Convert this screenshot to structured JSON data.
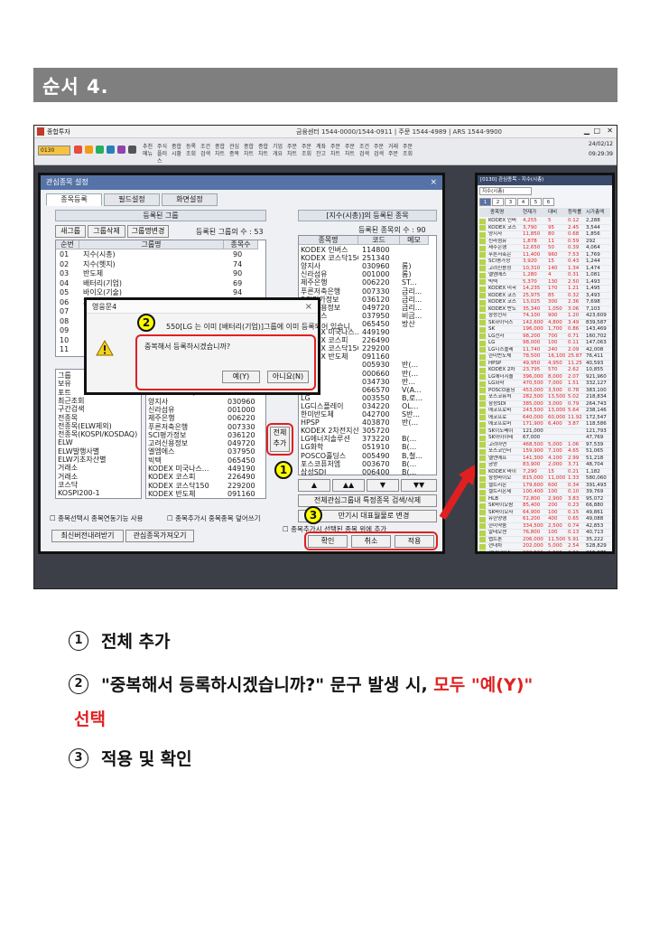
{
  "header": {
    "title": "순서 4."
  },
  "window": {
    "app_title": "종합투자",
    "center_info": "금융센터 1544-0000/1544-0911 | 주문 1544-4989 | ARS 1544-9900",
    "screen_no": "0130",
    "date": "24/02/12",
    "time": "09:29:39",
    "toolbar_items": [
      "추천메뉴",
      "주식플러스",
      "종합시황",
      "등록조회",
      "조건검색",
      "종합차트",
      "관심종목",
      "종합차트",
      "종합차트",
      "기업개요",
      "주문차트",
      "주문조회",
      "계좌잔고",
      "주문차트",
      "주문차트",
      "조건검색",
      "주문검색",
      "거래주문",
      "주문조회"
    ]
  },
  "dialog": {
    "title": "관심종목 설정",
    "close": "×",
    "tabs": [
      "종목등록",
      "필드설정",
      "화면설정"
    ],
    "group_panel": {
      "caption": "등록된 그룹",
      "buttons": [
        "새그룹",
        "그룹삭제",
        "그룹명변경"
      ],
      "count_label": "등록된 그룹의 수 : 53",
      "columns": [
        "순번",
        "그룹명",
        "종목수"
      ],
      "rows": [
        [
          "01",
          "지수(시총)",
          "90"
        ],
        [
          "02",
          "지수(헷지)",
          "74"
        ],
        [
          "03",
          "반도체",
          "90"
        ],
        [
          "04",
          "배터리(기업)",
          "69"
        ],
        [
          "05",
          "바이오(기술)",
          "94"
        ],
        [
          "06",
          "자동차(기업)",
          "86"
        ],
        [
          "07",
          "",
          ""
        ],
        [
          "08",
          "",
          ""
        ],
        [
          "09",
          "",
          ""
        ],
        [
          "10",
          "",
          ""
        ],
        [
          "11",
          "",
          ""
        ]
      ]
    },
    "category_list": [
      "그룹",
      "보유",
      "포트",
      "최근조회",
      "구간검색",
      "전종목",
      "전종목(ELW제외)",
      "전종목(KOSPI/KOSDAQ)",
      "ELW",
      "ELW발행사별",
      "ELW기초자산별",
      "거래소",
      "거래소",
      "코스닥",
      "KOSPI200-1"
    ],
    "stock_mid": [
      [
        "KODEX 인버스",
        "114800"
      ],
      [
        "KODEX 코스닥15...",
        "251340"
      ],
      [
        "양지사",
        "030960"
      ],
      [
        "신라섬유",
        "001000"
      ],
      [
        "제주은행",
        "006220"
      ],
      [
        "푸른저축은행",
        "007330"
      ],
      [
        "SCI평가정보",
        "036120"
      ],
      [
        "고려신용정보",
        "049720"
      ],
      [
        "엘엠에스",
        "037950"
      ],
      [
        "빅텍",
        "065450"
      ],
      [
        "KODEX 미국나스...",
        "449190"
      ],
      [
        "KODEX 코스피",
        "226490"
      ],
      [
        "KODEX 코스닥150",
        "229200"
      ],
      [
        "KODEX 반도체",
        "091160"
      ]
    ],
    "add_all_button": "전체추가",
    "registered_panel": {
      "caption": "[지수(시총)]의 등록된 종목",
      "count_label": "등록된 종목의 수 : 90",
      "columns": [
        "종목명",
        "코드",
        "메모"
      ],
      "rows": [
        [
          "KODEX 인버스",
          "114800",
          ""
        ],
        [
          "KODEX 코스닥150...",
          "251340",
          ""
        ],
        [
          "양지사",
          "030960",
          "롬)"
        ],
        [
          "신라섬유",
          "001000",
          "롬)"
        ],
        [
          "제주은행",
          "006220",
          "ST..."
        ],
        [
          "푸른저축은행",
          "007330",
          "금리..."
        ],
        [
          "SCI평가정보",
          "036120",
          "금리..."
        ],
        [
          "고려신용정보",
          "049720",
          "금리..."
        ],
        [
          "엘엠에스",
          "037950",
          "비금..."
        ],
        [
          "빅텍",
          "065450",
          "방산"
        ],
        [
          "KODEX 미국나스...",
          "449190",
          ""
        ],
        [
          "KODEX 코스피",
          "226490",
          ""
        ],
        [
          "KODEX 코스닥150",
          "229200",
          ""
        ],
        [
          "KODEX 반도체",
          "091160",
          ""
        ],
        [
          "",
          "005930",
          "반(..."
        ],
        [
          "",
          "000660",
          "반(..."
        ],
        [
          "",
          "034730",
          "반..."
        ],
        [
          "",
          "066570",
          "V(A..."
        ],
        [
          "LG",
          "003550",
          "B,로..."
        ],
        [
          "LG디스플레이",
          "034220",
          "OL..."
        ],
        [
          "한미반도체",
          "042700",
          "S반..."
        ],
        [
          "HPSP",
          "403870",
          "반(..."
        ],
        [
          "KODEX 2차전지산업",
          "305720",
          ""
        ],
        [
          "LG에너지솔루션",
          "373220",
          "B(..."
        ],
        [
          "LG화학",
          "051910",
          "B(..."
        ],
        [
          "POSCO홀딩스",
          "005490",
          "B,철..."
        ],
        [
          "포스코퓨처엠",
          "003670",
          "B(..."
        ],
        [
          "삼성SDI",
          "006400",
          "B(..."
        ]
      ],
      "nav_buttons": [
        "▲",
        "▲▲",
        "▼",
        "▼▼"
      ],
      "search_button": "전체관심그룹내 특정종목 검색/삭제",
      "expiry_button": "만기시 대표월물로 변경"
    },
    "options": [
      "종목선택시 종목연동기능 사용",
      "종목추가시 중복종목 덮어쓰기",
      "종목추가시 선택된 종목 위에 추가"
    ],
    "bottom_left_buttons": [
      "최신버전내려받기",
      "관심종목가져오기"
    ],
    "footer_buttons": [
      "확인",
      "취소",
      "적용"
    ]
  },
  "popup": {
    "title": "영웅문4",
    "line1": "550[LG 는 이미 [배터리(기업)]그룹에 이미 등록되어 있습니",
    "line2": "중복해서 등록하시겠습니까?",
    "yes": "예(Y)",
    "no": "아니요(N)",
    "close": "×"
  },
  "right_panel": {
    "title": "[0130] 관심종목 - 지수(시총)",
    "combo": "지수(시총)",
    "tabs": [
      "1",
      "2",
      "3",
      "4",
      "5",
      "6"
    ],
    "columns": [
      "종목명",
      "현재가",
      "대비",
      "등락률",
      "시가총액"
    ],
    "rows": [
      [
        "KODEX 인버",
        "4,255",
        "5",
        "0.12",
        "2,288"
      ],
      [
        "KODEX 코스",
        "3,790",
        "95",
        "2.45",
        "3,544"
      ],
      [
        "양지사",
        "11,850",
        "80",
        "0.68",
        "1,856"
      ],
      [
        "신라섬유",
        "1,878",
        "11",
        "0.59",
        "292"
      ],
      [
        "제주은행",
        "12,650",
        "50",
        "0.39",
        "4,064"
      ],
      [
        "푸른저축은",
        "11,400",
        "960",
        "7.53",
        "1,769"
      ],
      [
        "SCI평가정",
        "3,920",
        "15",
        "0.43",
        "1,244"
      ],
      [
        "고려신용정",
        "10,310",
        "140",
        "1.34",
        "1,474"
      ],
      [
        "엘엠에스",
        "1,280",
        "4",
        "0.31",
        "1,081"
      ],
      [
        "빅텍",
        "5,370",
        "130",
        "2.50",
        "1,493"
      ],
      [
        "KODEX 미국",
        "14,235",
        "170",
        "1.21",
        "1,495"
      ],
      [
        "KODEX 코스",
        "25,975",
        "85",
        "0.32",
        "3,493"
      ],
      [
        "KODEX 코스",
        "13,025",
        "300",
        "2.36",
        "7,698"
      ],
      [
        "KODEX 반도",
        "35,340",
        "1,050",
        "3.06",
        "7,103"
      ],
      [
        "삼성전자",
        "74,100",
        "900",
        "1.20",
        "423,609"
      ],
      [
        "SK하이닉스",
        "142,600",
        "4,800",
        "3.49",
        "839,587"
      ],
      [
        "SK",
        "196,000",
        "1,700",
        "0.86",
        "143,469"
      ],
      [
        "LG전자",
        "98,200",
        "700",
        "0.71",
        "160,702"
      ],
      [
        "LG",
        "98,000",
        "100",
        "0.11",
        "147,063"
      ],
      [
        "LG디스플레",
        "11,740",
        "240",
        "2.09",
        "42,008"
      ],
      [
        "한미반도체",
        "78,500",
        "16,100",
        "25.87",
        "76,411"
      ],
      [
        "HPSP",
        "49,950",
        "4,950",
        "11.25",
        "40,593"
      ],
      [
        "KODEX 2차",
        "23,795",
        "570",
        "2.62",
        "10,855"
      ],
      [
        "LG에너지솔",
        "396,000",
        "8,000",
        "2.07",
        "921,960"
      ],
      [
        "LG화학",
        "470,500",
        "7,000",
        "1.51",
        "332,127"
      ],
      [
        "POSCO홀딩",
        "453,000",
        "3,500",
        "0.78",
        "383,100"
      ],
      [
        "포스코퓨처",
        "282,500",
        "13,500",
        "5.02",
        "218,834"
      ],
      [
        "삼성SDI",
        "385,000",
        "3,000",
        "0.79",
        "264,743"
      ],
      [
        "에코프로비",
        "243,500",
        "13,000",
        "5.64",
        "238,146"
      ],
      [
        "에코프로",
        "640,000",
        "60,000",
        "11.92",
        "172,547"
      ],
      [
        "에코프로머",
        "171,900",
        "6,400",
        "3.87",
        "118,586"
      ],
      [
        "SK이노베이",
        "121,000",
        "",
        "",
        "121,793"
      ],
      [
        "SK아이이테",
        "67,000",
        "",
        "",
        "47,769"
      ],
      [
        "고려아연",
        "468,500",
        "5,000",
        "1.06",
        "97,539"
      ],
      [
        "포스코인터",
        "159,900",
        "7,100",
        "4.65",
        "51,065"
      ],
      [
        "엘앤에프",
        "141,300",
        "4,100",
        "2.99",
        "51,218"
      ],
      [
        "금양",
        "83,900",
        "2,000",
        "3.71",
        "48,704"
      ],
      [
        "KODEX 바이",
        "7,290",
        "15",
        "0.21",
        "1,182"
      ],
      [
        "삼성바이오",
        "815,000",
        "11,000",
        "1.33",
        "580,060"
      ],
      [
        "셀트리온",
        "179,600",
        "600",
        "0.34",
        "391,493"
      ],
      [
        "셀트리온제",
        "100,400",
        "100",
        "0.10",
        "39,769"
      ],
      [
        "HLB",
        "72,800",
        "2,900",
        "3.83",
        "95,072"
      ],
      [
        "SK바이오팜",
        "85,400",
        "200",
        "0.23",
        "66,880"
      ],
      [
        "SK바이오사",
        "64,900",
        "100",
        "0.15",
        "49,861"
      ],
      [
        "유한양행",
        "61,200",
        "400",
        "0.65",
        "49,088"
      ],
      [
        "한미약품",
        "334,500",
        "2,500",
        "0.74",
        "42,853"
      ],
      [
        "알테오젠",
        "76,800",
        "100",
        "0.13",
        "40,713"
      ],
      [
        "펩트론",
        "206,000",
        "11,500",
        "5.91",
        "35,222"
      ],
      [
        "현대차",
        "202,000",
        "5,000",
        "2.54",
        "528,829"
      ],
      [
        "현대모비스",
        "230,500",
        "1,500",
        "0.66",
        "215,875"
      ]
    ]
  },
  "annotations": {
    "badge1": "1",
    "badge2": "2",
    "badge3": "3"
  },
  "steps": [
    {
      "num": "①",
      "text": "전체 추가"
    },
    {
      "num": "②",
      "text_a": "\"중복해서 등록하시겠습니까?\" 문구 발생 시,",
      "text_red": "모두 \"예(Y)\"",
      "text_cont": "선택"
    },
    {
      "num": "③",
      "text": "적용 및 확인"
    }
  ],
  "colors": {
    "accent_red": "#e02020",
    "header_gray": "#7f7f7f",
    "badge_yellow": "#ffff00",
    "dialog_blue": "#5573a6"
  }
}
